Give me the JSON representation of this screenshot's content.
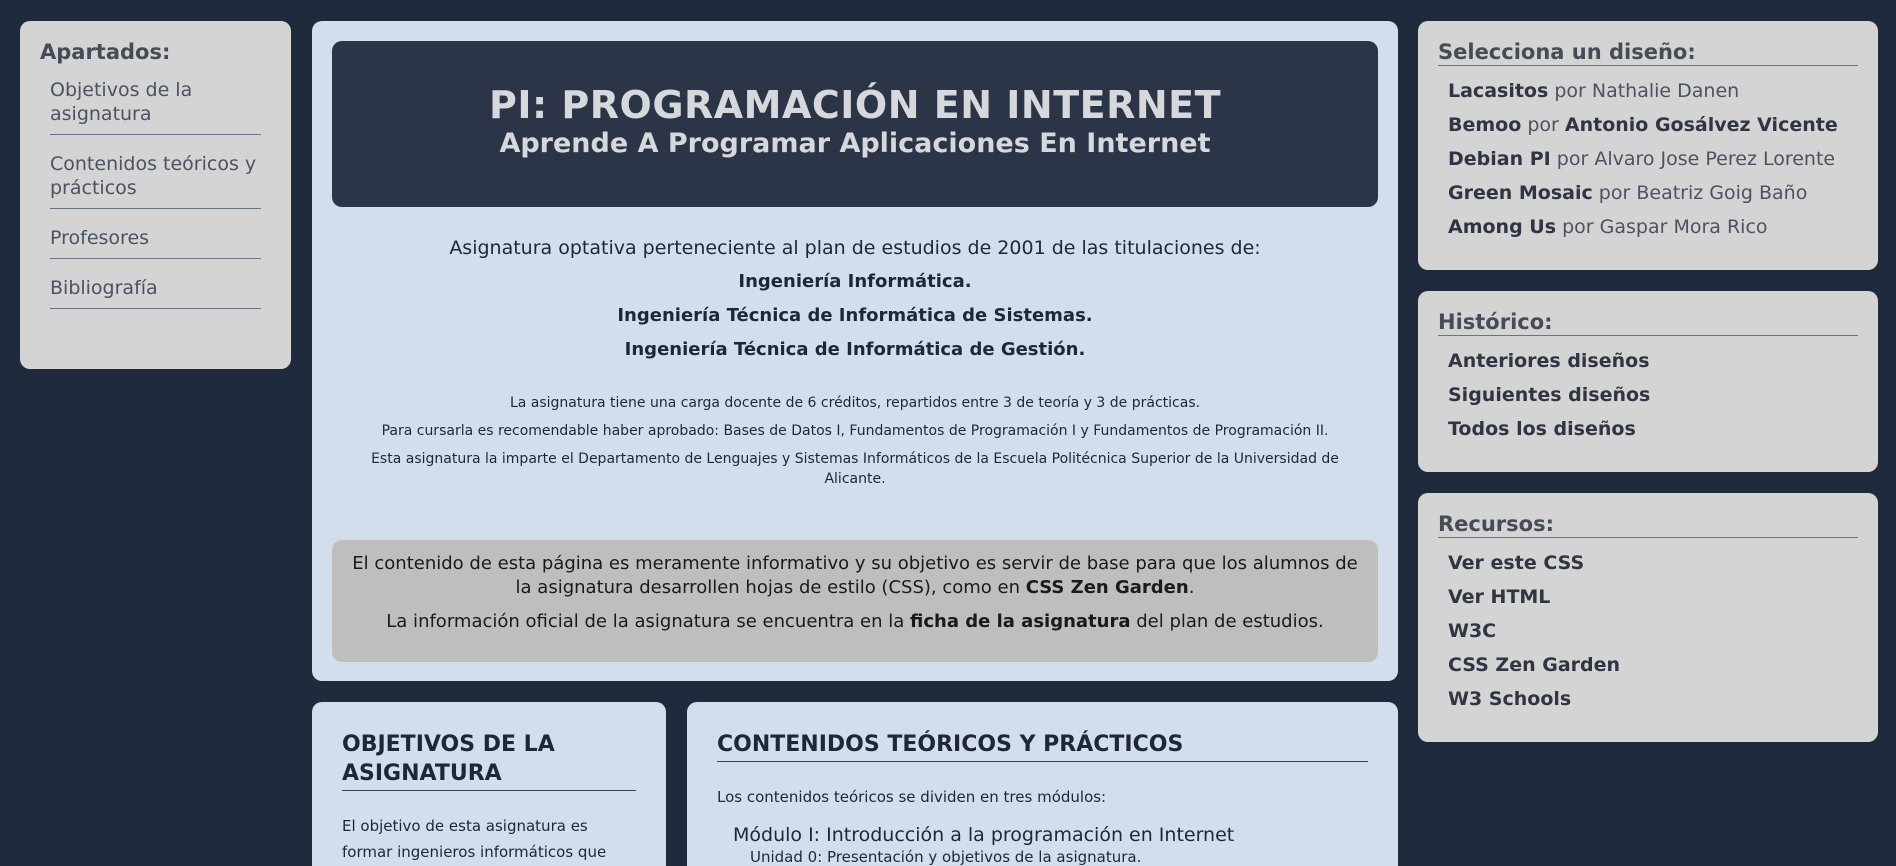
{
  "left_nav": {
    "title": "Apartados:",
    "items": [
      {
        "label": "Objetivos de la asignatura"
      },
      {
        "label": "Contenidos teóricos y prácticos"
      },
      {
        "label": "Profesores"
      },
      {
        "label": "Bibliografía"
      }
    ]
  },
  "header": {
    "title": "PI: PROGRAMACIÓN EN INTERNET",
    "subtitle": "Aprende A Programar Aplicaciones En Internet"
  },
  "intro": {
    "lead": "Asignatura optativa perteneciente al plan de estudios de 2001 de las titulaciones de:",
    "degrees": [
      "Ingeniería Informática.",
      "Ingeniería Técnica de Informática de Sistemas.",
      "Ingeniería Técnica de Informática de Gestión."
    ],
    "details": [
      "La asignatura tiene una carga docente de 6 créditos, repartidos entre 3 de teoría y 3 de prácticas.",
      "Para cursarla es recomendable haber aprobado: Bases de Datos I, Fundamentos de Programación I y Fundamentos de Programación II.",
      "Esta asignatura la imparte el Departamento de Lenguajes y Sistemas Informáticos de la Escuela Politécnica Superior de la Universidad de Alicante."
    ]
  },
  "note": {
    "p1_before": "El contenido de esta página es meramente informativo y su objetivo es servir de base para que los alumnos de la asignatura desarrollen hojas de estilo (CSS), como en ",
    "p1_link": "CSS Zen Garden",
    "p1_after": ".",
    "p2_before": "La información oficial de la asignatura se encuentra en la ",
    "p2_link": "ficha de la asignatura",
    "p2_after": " del plan de estudios."
  },
  "objetivos": {
    "title": "OBJETIVOS DE LA ASIGNATURA",
    "text": "El objetivo de esta asignatura es formar ingenieros informáticos que"
  },
  "contenidos": {
    "title": "CONTENIDOS TEÓRICOS Y PRÁCTICOS",
    "intro": "Los contenidos teóricos se dividen en tres módulos:",
    "module": "Módulo I: Introducción a la programación en Internet",
    "unit": "Unidad 0: Presentación y objetivos de la asignatura."
  },
  "designs": {
    "title": "Selecciona un diseño:",
    "by": "por",
    "items": [
      {
        "name": "Lacasitos",
        "author": "Nathalie Danen",
        "author_bold": false
      },
      {
        "name": "Bemoo",
        "author": "Antonio Gosálvez Vicente",
        "author_bold": true
      },
      {
        "name": "Debian PI",
        "author": "Alvaro Jose Perez Lorente",
        "author_bold": false
      },
      {
        "name": "Green Mosaic",
        "author": "Beatriz Goig Baño",
        "author_bold": false
      },
      {
        "name": "Among Us",
        "author": "Gaspar Mora Rico",
        "author_bold": false
      }
    ]
  },
  "history": {
    "title": "Histórico:",
    "items": [
      "Anteriores diseños",
      "Siguientes diseños",
      "Todos los diseños"
    ]
  },
  "resources": {
    "title": "Recursos:",
    "items": [
      "Ver este CSS",
      "Ver HTML",
      "W3C",
      "CSS Zen Garden",
      "W3 Schools"
    ]
  },
  "colors": {
    "background": "#1f2a3d",
    "header": "#2c3548",
    "panel_blue": "#d2deec",
    "panel_grey": "#d4d4d4",
    "note_grey": "#bebebe"
  }
}
